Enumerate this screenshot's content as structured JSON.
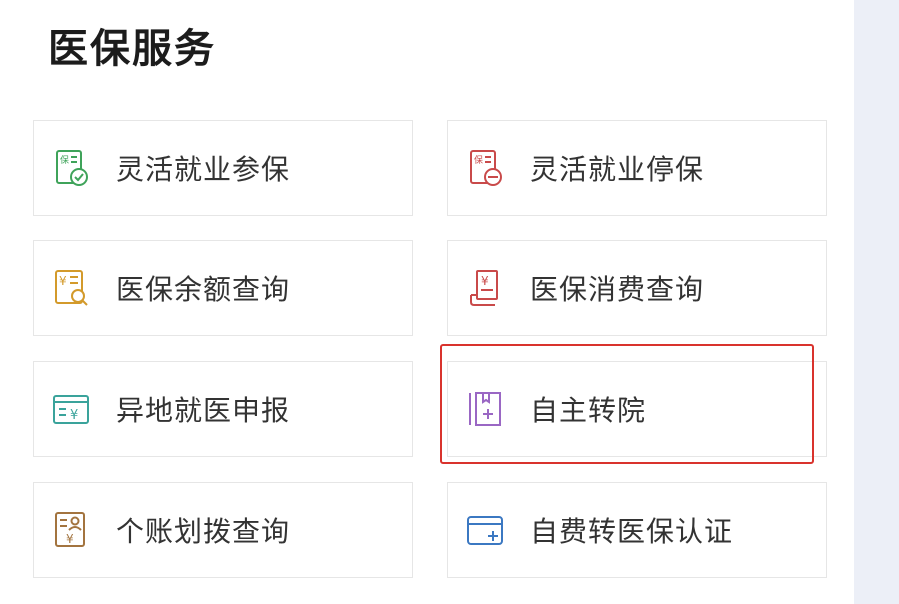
{
  "section_title": "医保服务",
  "tiles": [
    {
      "label": "灵活就业参保",
      "icon": "insurance-check-icon",
      "color": "#3fa35a"
    },
    {
      "label": "灵活就业停保",
      "icon": "insurance-stop-icon",
      "color": "#c94a4a"
    },
    {
      "label": "医保余额查询",
      "icon": "balance-search-icon",
      "color": "#d39a2b"
    },
    {
      "label": "医保消费查询",
      "icon": "receipt-icon",
      "color": "#c94a4a"
    },
    {
      "label": "异地就医申报",
      "icon": "card-yuan-icon",
      "color": "#3aa39b"
    },
    {
      "label": "自主转院",
      "icon": "hospital-transfer-icon",
      "color": "#9a67c4"
    },
    {
      "label": "个账划拨查询",
      "icon": "account-transfer-icon",
      "color": "#a3743f"
    },
    {
      "label": "自费转医保认证",
      "icon": "card-plus-icon",
      "color": "#3b78c2"
    }
  ],
  "highlight_color": "#d9332d"
}
